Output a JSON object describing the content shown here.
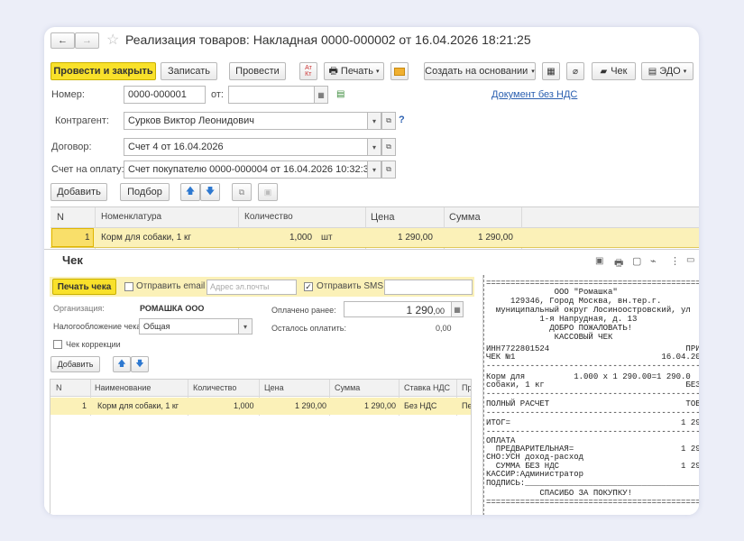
{
  "window": {
    "title": "Реализация товаров: Накладная 0000-000002 от 16.04.2026 18:21:25",
    "nav_back": "←",
    "nav_forward": "→",
    "star": "☆"
  },
  "toolbar": {
    "post_close": "Провести и закрыть",
    "save": "Записать",
    "post": "Провести",
    "print": "Печать",
    "create_based": "Создать на основании",
    "receipt": "Чек",
    "edo": "ЭДО"
  },
  "header": {
    "number_label": "Номер:",
    "number_value": "0000-000001",
    "date_label": "от:",
    "date_value": "",
    "doc_link": "Документ без НДС",
    "counterparty_label": "Контрагент:",
    "counterparty_value": "Сурков Виктор Леонидович",
    "help": "?",
    "contract_label": "Договор:",
    "contract_value": "Счет 4 от 16.04.2026",
    "invoice_label": "Счет на оплату:",
    "invoice_value": "Счет покупателю 0000-000004 от 16.04.2026 10:32:35"
  },
  "items_toolbar": {
    "add": "Добавить",
    "pick": "Подбор"
  },
  "items_table": {
    "columns": [
      "N",
      "Номенклатура",
      "Количество",
      "Цена",
      "Сумма"
    ],
    "rows": [
      {
        "n": "1",
        "name": "Корм для собаки, 1 кг",
        "qty": "1,000",
        "unit": "шт",
        "price": "1 290,00",
        "sum": "1 290,00"
      }
    ]
  },
  "check_panel": {
    "title": "Чек",
    "print_button": "Печать чека",
    "send_email": "Отправить email",
    "email_placeholder": "Адрес эл.почты",
    "send_sms": "Отправить SMS",
    "sms_value": "",
    "org_label": "Организация:",
    "org_value": "РОМАШКА ООО",
    "tax_label": "Налогообложение чека:",
    "tax_value": "Общая",
    "prepaid_label": "Оплачено ранее:",
    "prepaid_value": "1 290",
    "prepaid_cents": ",00",
    "remain_label": "Осталось оплатить:",
    "remain_value": "0,00",
    "correction_label": "Чек коррекции",
    "add_button": "Добавить",
    "table": {
      "columns": [
        "N",
        "Наименование",
        "Количество",
        "Цена",
        "Сумма",
        "Ставка НДС",
        "Пр"
      ],
      "rows": [
        {
          "n": "1",
          "name": "Корм для собаки, 1 кг",
          "qty": "1,000",
          "price": "1 290,00",
          "sum": "1 290,00",
          "vat": "Без НДС",
          "pr": "Пе"
        }
      ]
    }
  },
  "receipt": {
    "lines": [
      "================================================",
      "              ООО \"Ромашка\"",
      "     129346, Город Москва, вн.тер.г.",
      "  муниципальный округ Лосиноостровский, ул",
      "           1-я Напрудная, д. 13",
      "             ДОБРО ПОЖАЛОВАТЬ!",
      "              КАССОВЫЙ ЧЕК",
      "ИНН7722801524                            ПРИХО",
      "ЧЕК №1                              16.04.202",
      "------------------------------------------------",
      "Корм для          1.000 x 1 290.00=1 290.0",
      "собаки, 1 кг                             БЕЗ НД",
      "------------------------------------------------",
      "ПОЛНЫЙ РАСЧЕТ                            ТОВАР",
      "------------------------------------------------",
      "ИТОГ=                                   1 290.0",
      "------------------------------------------------",
      "ОПЛАТА",
      "  ПРЕДВАРИТЕЛЬНАЯ=                      1 290.0",
      "СНО:УСН доход-расход",
      "  СУММА БЕЗ НДС                         1 290.0",
      "КАССИР:Администратор",
      "ПОДПИСЬ:_______________________________________",
      "           СПАСИБО ЗА ПОКУПКУ!",
      "================================================"
    ]
  }
}
